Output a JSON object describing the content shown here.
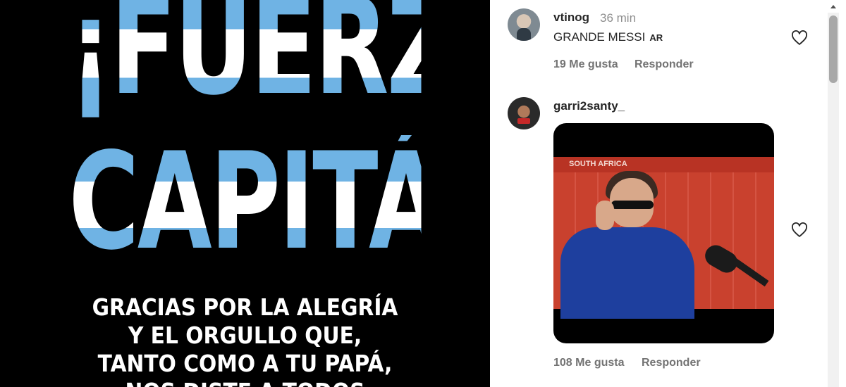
{
  "post": {
    "headline_line1": "¡FUERZA",
    "headline_line2": "CAPITÁN!",
    "sub_lines": [
      "GRACIAS POR LA ALEGRÍA",
      "Y EL ORGULLO QUE,",
      "TANTO COMO A TU PAPÁ,",
      "NOS DISTE A TODOS"
    ]
  },
  "comments": [
    {
      "username": "vtinog",
      "time": "36 min",
      "text": "GRANDE MESSI",
      "flag": "AR",
      "likes": "19 Me gusta",
      "reply_label": "Responder"
    },
    {
      "username": "garri2santy_",
      "gif_banner": "SOUTH AFRICA",
      "likes": "108 Me gusta",
      "reply_label": "Responder"
    }
  ],
  "icons": {
    "heart": "heart-outline-icon",
    "scroll_up": "caret-up-icon"
  },
  "colors": {
    "argentina_blue": "#6fb3e4",
    "text_primary": "#262626",
    "text_secondary": "#737373"
  }
}
